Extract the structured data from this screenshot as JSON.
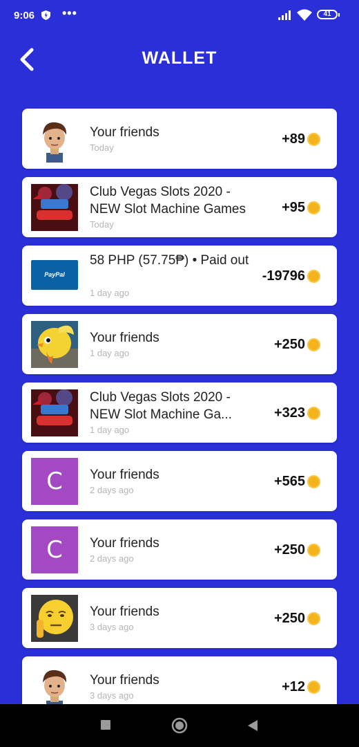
{
  "status": {
    "time": "9:06",
    "dots": "•••",
    "battery": "41"
  },
  "header": {
    "title": "WALLET",
    "back_icon": "chevron-left-icon"
  },
  "transactions": [
    {
      "name": "Your friends",
      "time": "Today",
      "amount": "+89",
      "avatar": "cartoon-boy"
    },
    {
      "name": "Club Vegas Slots 2020 - NEW Slot Machine Games",
      "time": "Today",
      "amount": "+95",
      "avatar": "club-vegas-logo"
    },
    {
      "name": "58 PHP (57.75₱) • Paid out",
      "time": "1 day ago",
      "amount": "-19796",
      "avatar": "paypal-logo",
      "avatar_text": "PayPal"
    },
    {
      "name": "Your friends",
      "time": "1 day ago",
      "amount": "+250",
      "avatar": "yellow-bird"
    },
    {
      "name": "Club Vegas Slots 2020 - NEW Slot Machine Ga...",
      "time": "1 day ago",
      "amount": "+323",
      "avatar": "club-vegas-logo"
    },
    {
      "name": "Your friends",
      "time": "2 days ago",
      "amount": "+565",
      "avatar": "letter",
      "avatar_text": "C"
    },
    {
      "name": "Your friends",
      "time": "2 days ago",
      "amount": "+250",
      "avatar": "letter",
      "avatar_text": "C"
    },
    {
      "name": "Your friends",
      "time": "3 days ago",
      "amount": "+250",
      "avatar": "emoji-face"
    },
    {
      "name": "Your friends",
      "time": "3 days ago",
      "amount": "+12",
      "avatar": "cartoon-boy"
    }
  ],
  "colors": {
    "background": "#2a2fd8",
    "coin": "#f4b21b",
    "avatar_letter_bg": "#a349c4"
  }
}
